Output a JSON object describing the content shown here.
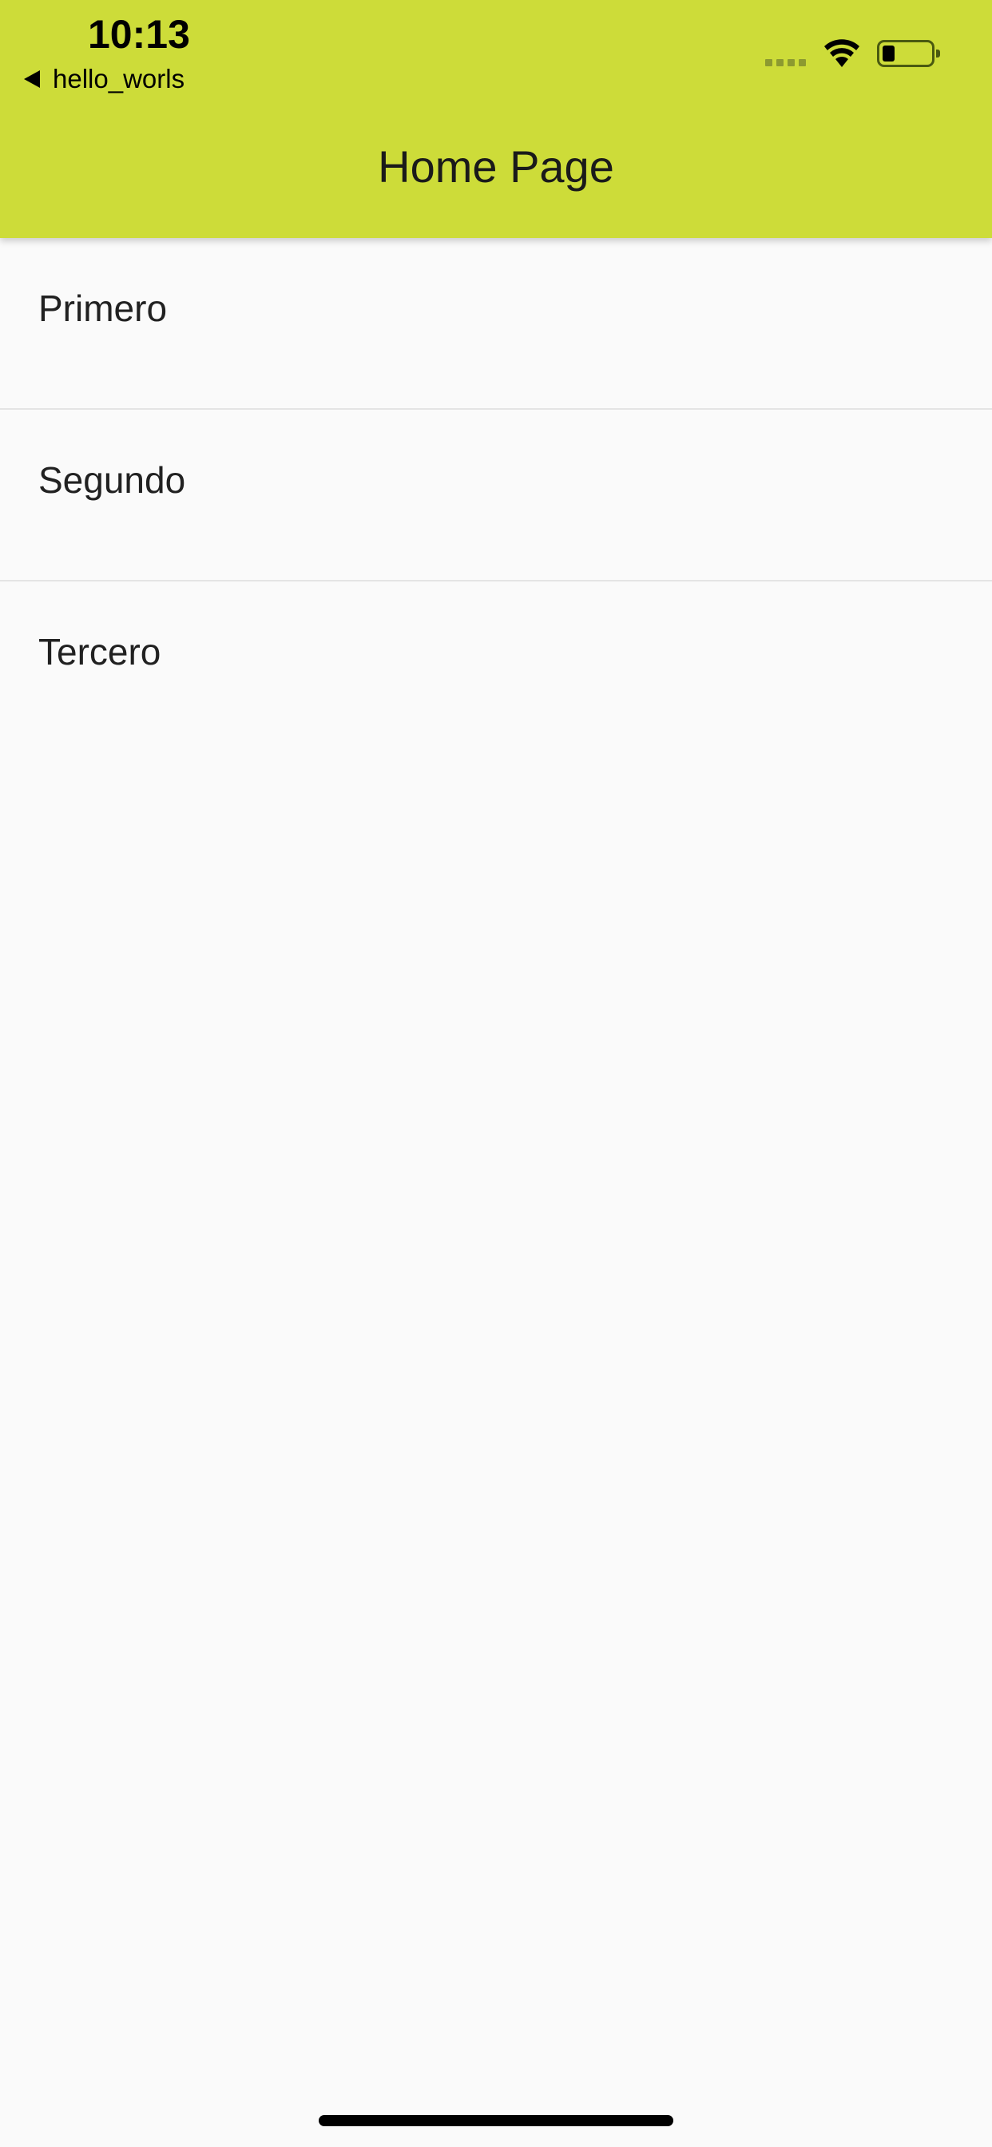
{
  "status_bar": {
    "time": "10:13",
    "back_app": "hello_worls",
    "icons": [
      "signal-dots-icon",
      "wifi-icon",
      "battery-icon"
    ],
    "battery_level_fraction": 0.25
  },
  "app_bar": {
    "title": "Home Page",
    "color": "#cddc39"
  },
  "list": {
    "items": [
      {
        "label": "Primero"
      },
      {
        "label": "Segundo"
      },
      {
        "label": "Tercero"
      }
    ]
  },
  "colors": {
    "background": "#fafafa",
    "divider": "#e4e4e4"
  }
}
